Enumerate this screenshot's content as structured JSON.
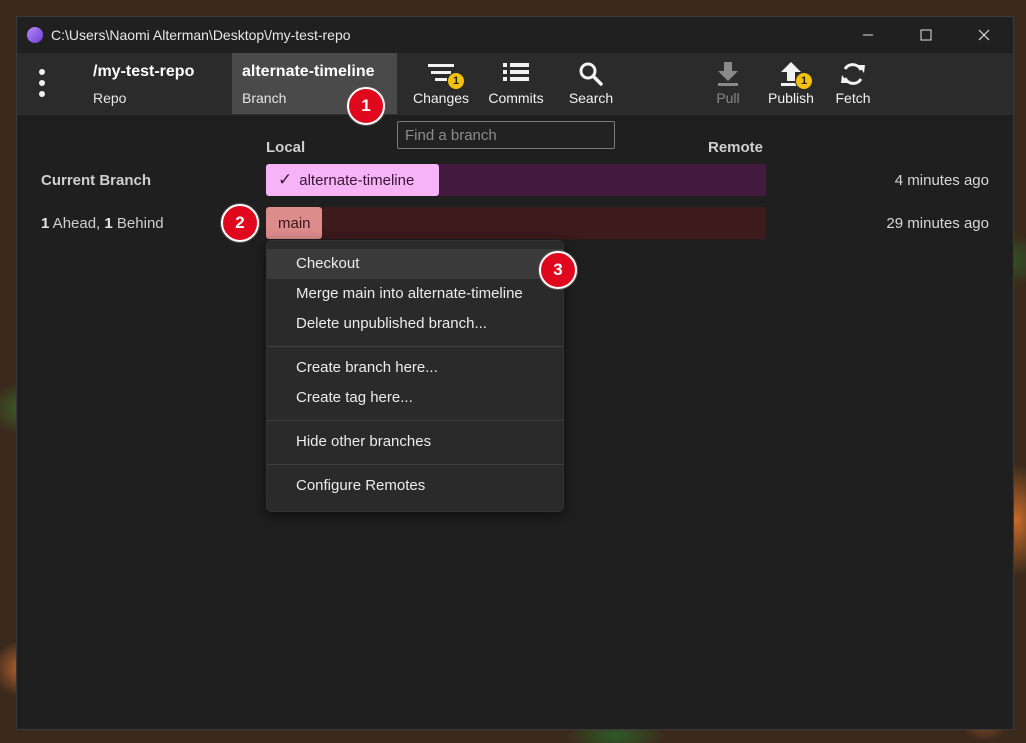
{
  "window": {
    "title": "C:\\Users\\Naomi Alterman\\Desktop\\/my-test-repo"
  },
  "toolbar": {
    "repo": {
      "name": "/my-test-repo",
      "label": "Repo"
    },
    "branch": {
      "name": "alternate-timeline",
      "label": "Branch"
    },
    "changes": {
      "label": "Changes",
      "badge": "1"
    },
    "commits": {
      "label": "Commits"
    },
    "search": {
      "label": "Search"
    },
    "pull": {
      "label": "Pull"
    },
    "publish": {
      "label": "Publish",
      "badge": "1"
    },
    "fetch": {
      "label": "Fetch"
    }
  },
  "branch_search": {
    "placeholder": "Find a branch"
  },
  "columns": {
    "local": "Local",
    "remote": "Remote"
  },
  "rows": [
    {
      "label": "Current Branch",
      "branch": "alternate-timeline",
      "check": "✓",
      "time": "4 minutes ago"
    },
    {
      "ahead_count": "1",
      "ahead_text": " Ahead, ",
      "behind_count": "1",
      "behind_text": " Behind",
      "branch": "main",
      "time": "29 minutes ago"
    }
  ],
  "context_menu": {
    "items": [
      "Checkout",
      "Merge main into alternate-timeline",
      "Delete unpublished branch...",
      "Create branch here...",
      "Create tag here...",
      "Hide other branches",
      "Configure Remotes"
    ]
  },
  "callouts": [
    "1",
    "2",
    "3"
  ],
  "colors": {
    "current_chip": "#f6b3f6",
    "current_track": "#421a40",
    "main_chip": "#dd8c8c",
    "main_track": "#3d1a1c",
    "badge": "#f4c20d",
    "callout": "#e0081c"
  }
}
